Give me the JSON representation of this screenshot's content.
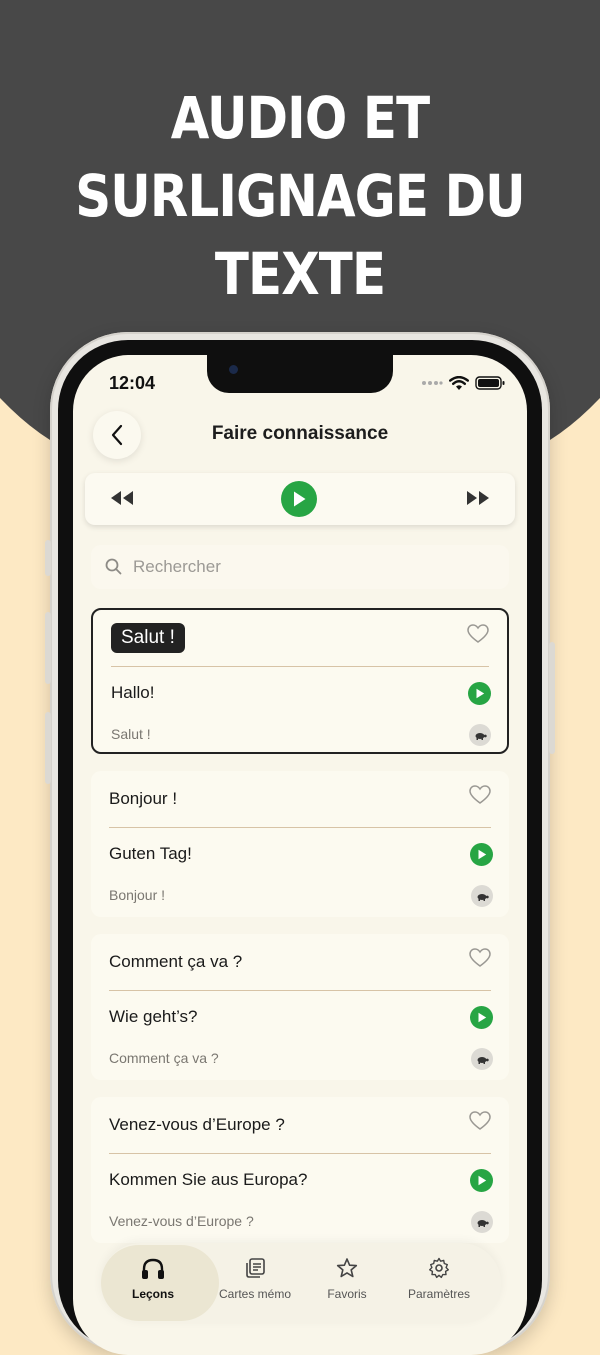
{
  "headline": {
    "line1": "AUDIO ET",
    "line2": "SURLIGNAGE DU",
    "line3": "TEXTE"
  },
  "colors": {
    "background_dark": "#484848",
    "background_cream": "#fde9c4",
    "accent_green": "#27a544",
    "screen_bg": "#f9f6ea"
  },
  "status_bar": {
    "time": "12:04",
    "icons": [
      "signal-dots-icon",
      "wifi-icon",
      "battery-icon"
    ]
  },
  "header": {
    "title": "Faire connaissance",
    "back_icon": "chevron-left-icon"
  },
  "player": {
    "icons": [
      "rewind-icon",
      "play-icon",
      "fast-forward-icon"
    ]
  },
  "search": {
    "placeholder": "Rechercher",
    "icon": "search-icon"
  },
  "cards": [
    {
      "french": "Salut !",
      "german": "Hallo!",
      "subtitle": "Salut !",
      "highlighted": true
    },
    {
      "french": "Bonjour !",
      "german": "Guten Tag!",
      "subtitle": "Bonjour !",
      "highlighted": false
    },
    {
      "french": "Comment ça va ?",
      "german": "Wie geht’s?",
      "subtitle": "Comment ça va ?",
      "highlighted": false
    },
    {
      "french": "Venez-vous d’Europe ?",
      "german": "Kommen Sie aus Europa?",
      "subtitle": "Venez-vous d’Europe ?",
      "highlighted": false
    }
  ],
  "tabbar": {
    "items": [
      {
        "label": "Leçons",
        "icon": "headphones-icon",
        "selected": true
      },
      {
        "label": "Cartes mémo",
        "icon": "flashcards-icon",
        "selected": false
      },
      {
        "label": "Favoris",
        "icon": "star-icon",
        "selected": false
      },
      {
        "label": "Paramètres",
        "icon": "gear-icon",
        "selected": false
      }
    ]
  }
}
